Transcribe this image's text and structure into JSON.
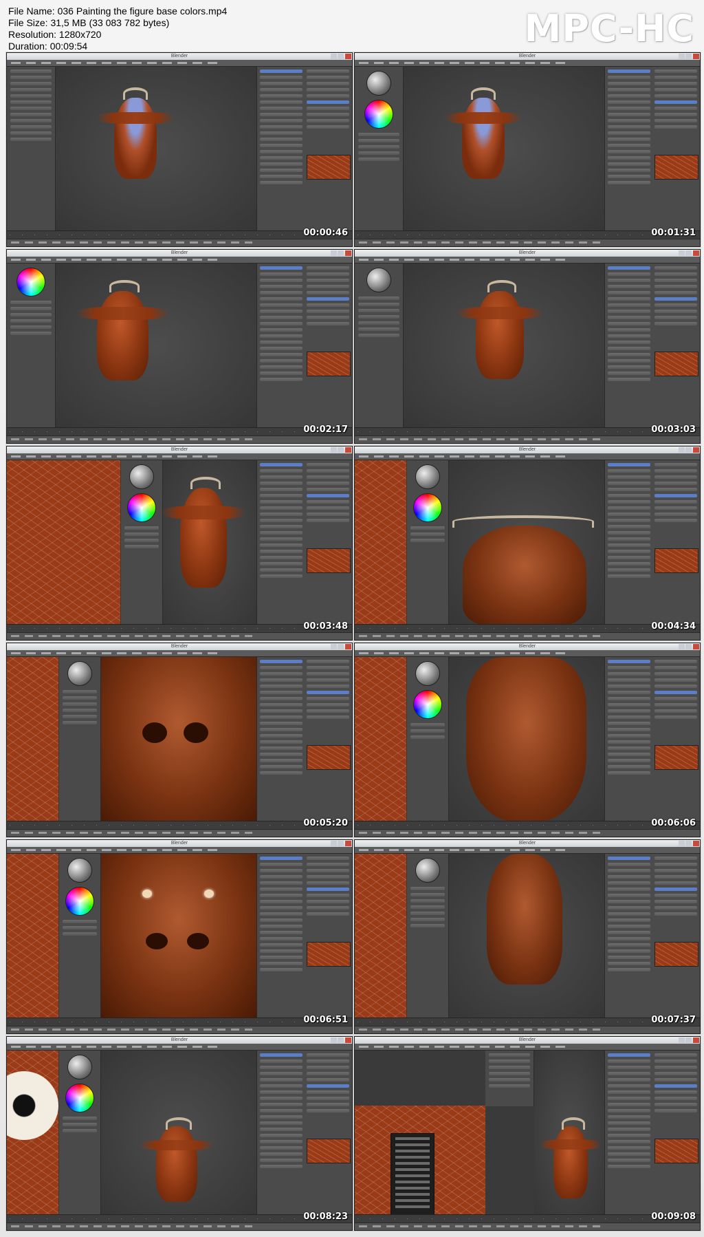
{
  "header": {
    "file_name": "File Name: 036 Painting the figure base colors.mp4",
    "file_size": "File Size: 31,5 MB (33 083 782 bytes)",
    "resolution": "Resolution: 1280x720",
    "duration": "Duration: 00:09:54"
  },
  "brand": "MPC-HC",
  "thumbnails": [
    {
      "title": "Blender",
      "timestamp": "00:00:46"
    },
    {
      "title": "Blender",
      "timestamp": "00:01:31"
    },
    {
      "title": "Blender",
      "timestamp": "00:02:17"
    },
    {
      "title": "Blender",
      "timestamp": "00:03:03"
    },
    {
      "title": "Blender",
      "timestamp": "00:03:48"
    },
    {
      "title": "Blender",
      "timestamp": "00:04:34"
    },
    {
      "title": "Blender",
      "timestamp": "00:05:20"
    },
    {
      "title": "Blender",
      "timestamp": "00:06:06"
    },
    {
      "title": "Blender",
      "timestamp": "00:06:51"
    },
    {
      "title": "Blender",
      "timestamp": "00:07:37"
    },
    {
      "title": "Blender",
      "timestamp": "00:08:23"
    },
    {
      "title": "Blender",
      "timestamp": "00:09:08"
    }
  ]
}
